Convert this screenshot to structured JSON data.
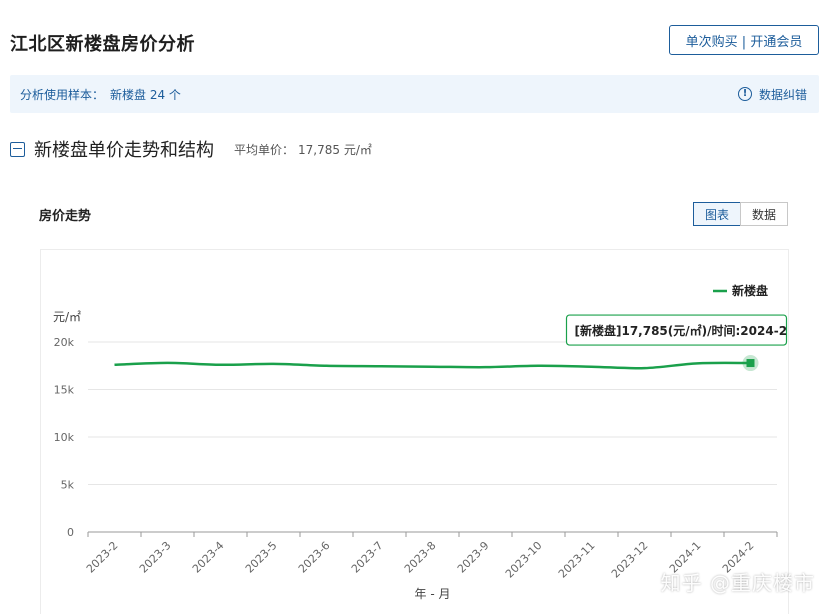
{
  "header": {
    "title": "江北区新楼盘房价分析",
    "buy_label": "单次购买 | 开通会员"
  },
  "sample": {
    "label": "分析使用样本：",
    "value": "新楼盘 24 个",
    "correct_label": "数据纠错"
  },
  "section": {
    "title": "新楼盘单价走势和结构",
    "avg_label": "平均单价：",
    "avg_value": "17,785 元/㎡"
  },
  "chart_panel": {
    "title": "房价走势",
    "tab_chart": "图表",
    "tab_data": "数据"
  },
  "watermark": "知乎 @重庆楼市",
  "colors": {
    "accent": "#1d5d9b",
    "series": "#1aa04b",
    "tooltip_border": "#1aa04b",
    "sample_bg": "#eef5fc"
  },
  "chart_data": {
    "type": "line",
    "x": [
      "2023-2",
      "2023-3",
      "2023-4",
      "2023-5",
      "2023-6",
      "2023-7",
      "2023-8",
      "2023-9",
      "2023-10",
      "2023-11",
      "2023-12",
      "2024-1",
      "2024-2"
    ],
    "series": [
      {
        "name": "新楼盘",
        "values": [
          17600,
          17800,
          17600,
          17700,
          17500,
          17450,
          17400,
          17350,
          17500,
          17400,
          17250,
          17750,
          17785
        ]
      }
    ],
    "ylabel": "元/㎡",
    "xlabel": "年 - 月",
    "ylim": [
      0,
      20000
    ],
    "yticks": [
      "0",
      "5k",
      "10k",
      "15k",
      "20k"
    ],
    "ytick_values": [
      0,
      5000,
      10000,
      15000,
      20000
    ],
    "legend": "top-right",
    "grid": true,
    "tooltip": "[新楼盘]17,785(元/㎡)/时间:2024-2"
  }
}
